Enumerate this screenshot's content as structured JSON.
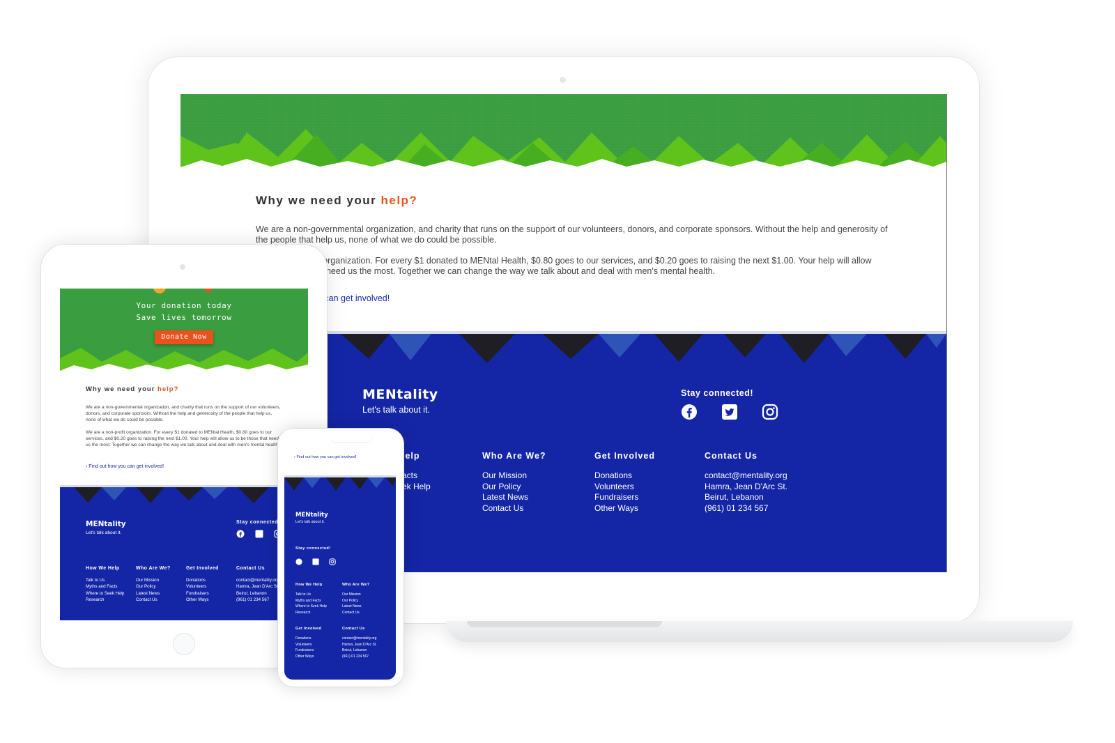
{
  "desktop": {
    "heading": {
      "text": "Why we need your ",
      "accent": "help?"
    },
    "paragraphs": [
      "We are a non-governmental organization, and charity that runs on the support of our volunteers, donors, and corporate sponsors. Without the help and generosity of the people that help us, none of what we do could be possible.",
      "fit organization. For every $1 donated to MENtal Health, $0.80  goes to our services, and $0.20 goes to raising the next $1.00. Your help will allow",
      "t need us the most. Together we can change the way we talk about and deal with men's mental health."
    ],
    "cta_link": "u can get involved!",
    "footer": {
      "brand": "MENtality",
      "tagline": "Let's talk about it.",
      "stay_connected": "Stay connected!",
      "social_icons": [
        "facebook-icon",
        "twitter-icon",
        "instagram-icon"
      ],
      "columns": [
        {
          "title": "lelp",
          "items": [
            "",
            "acts",
            "ek Help"
          ]
        },
        {
          "title": "Who Are We?",
          "items": [
            "Our Mission",
            "Our Policy",
            "Latest News",
            "Contact Us"
          ]
        },
        {
          "title": "Get Involved",
          "items": [
            "Donations",
            "Volunteers",
            "Fundraisers",
            "Other Ways"
          ]
        },
        {
          "title": "Contact Us",
          "items": [
            "contact@mentality.org",
            "Hamra, Jean D'Arc St.",
            "Beirut, Lebanon",
            "(961) 01 234 567"
          ]
        }
      ]
    }
  },
  "tablet": {
    "hero_line1": "Your donation today",
    "hero_line2": "Save lives tomorrow",
    "donate_button": "Donate Now",
    "heading": {
      "text": "Why we need your ",
      "accent": "help?"
    },
    "paragraphs": [
      "We are a non-governmental organization, and charity that runs on the support of our volunteers, donors, and corporate sponsors. Without the help and generosity of the people that help us, none of what we do could be possible.",
      "We are a non-profit organization. For every $1 donated to MENtal Health, $0.80 goes to our services, and $0.20 goes to raising the next $1.00. Your help will allow us to be those that need us the most. Together we can change the way we talk about and deal with men's mental health."
    ],
    "cta_link": "Find out how you can get involved!",
    "footer": {
      "brand": "MENtality",
      "tagline": "Let's talk about it.",
      "stay_connected": "Stay connected",
      "columns": [
        {
          "title": "How We Help",
          "items": [
            "Talk to Us",
            "Myths and Facts",
            "Where to Seek Help",
            "Research"
          ]
        },
        {
          "title": "Who Are We?",
          "items": [
            "Our Mission",
            "Our Policy",
            "Latest News",
            "Contact Us"
          ]
        },
        {
          "title": "Get Involved",
          "items": [
            "Donations",
            "Volunteers",
            "Fundraisers",
            "Other Ways"
          ]
        },
        {
          "title": "Contact Us",
          "items": [
            "contact@mentality.org",
            "Hamra, Jean D'Arc St.",
            "Beirut, Lebanon",
            "(961) 01 234 567"
          ]
        }
      ]
    }
  },
  "phone": {
    "cta_link": "Find out how you can get involved!",
    "footer": {
      "brand": "MENtality",
      "tagline": "Let's talk about it.",
      "stay_connected": "Stay connected!",
      "columns": [
        {
          "title": "How We Help",
          "items": [
            "Talk to Us",
            "Myths and Facts",
            "Where to Seek Help",
            "Research"
          ]
        },
        {
          "title": "Who Are We?",
          "items": [
            "Our Mission",
            "Our Policy",
            "Latest News",
            "Contact Us"
          ]
        },
        {
          "title": "Get Involved",
          "items": [
            "Donations",
            "Volunteers",
            "Fundraisers",
            "Other Ways"
          ]
        },
        {
          "title": "Contact Us",
          "items": [
            "contact@mentality.org",
            "Hamra, Jean D'Arc St.",
            "Beirut, Lebanon",
            "(961) 01 234 567"
          ]
        }
      ]
    }
  },
  "colors": {
    "green": "#3a9d3f",
    "blue": "#1426a6",
    "orange": "#e8521d",
    "link": "#1a2aa8"
  }
}
